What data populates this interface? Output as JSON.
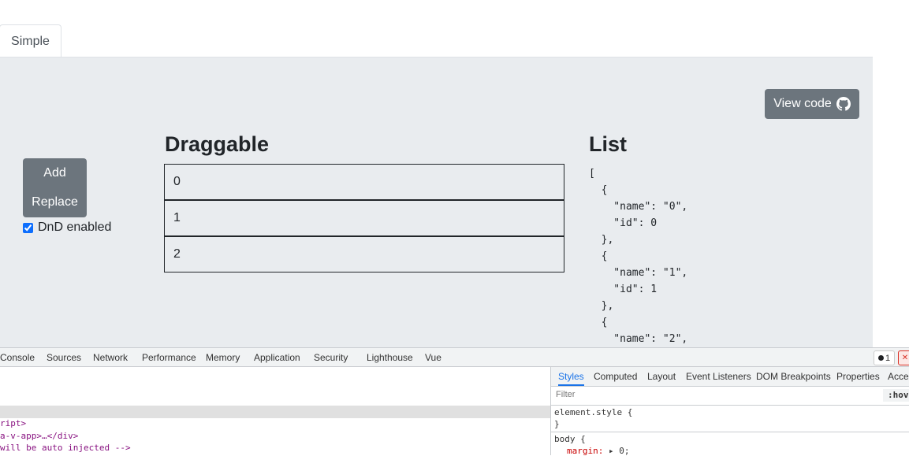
{
  "tabs": {
    "active": "Simple"
  },
  "panel": {
    "view_code_label": "View code",
    "buttons": {
      "add": "Add",
      "replace": "Replace"
    },
    "dnd_label": "DnD enabled",
    "dnd_checked": true,
    "draggable_heading": "Draggable",
    "list_heading": "List",
    "items": [
      "0",
      "1",
      "2"
    ],
    "json_text": "[\n  {\n    \"name\": \"0\",\n    \"id\": 0\n  },\n  {\n    \"name\": \"1\",\n    \"id\": 1\n  },\n  {\n    \"name\": \"2\","
  },
  "devtools": {
    "tabs": [
      "Console",
      "Sources",
      "Network",
      "Performance",
      "Memory",
      "Application",
      "Security",
      "Lighthouse",
      "Vue"
    ],
    "issue_count": "1",
    "elements_lines": [
      "ript>",
      "a-v-app>…</div>",
      "will be auto injected -->"
    ],
    "style_tabs": [
      "Styles",
      "Computed",
      "Layout",
      "Event Listeners",
      "DOM Breakpoints",
      "Properties",
      "Acces"
    ],
    "filter_placeholder": "Filter",
    "hov_label": ":hov",
    "rule1_selector": "element.style {",
    "rule1_close": "}",
    "rule2_selector": "body {",
    "rule2_prop": "margin:",
    "rule2_val": "▸ 0;"
  }
}
